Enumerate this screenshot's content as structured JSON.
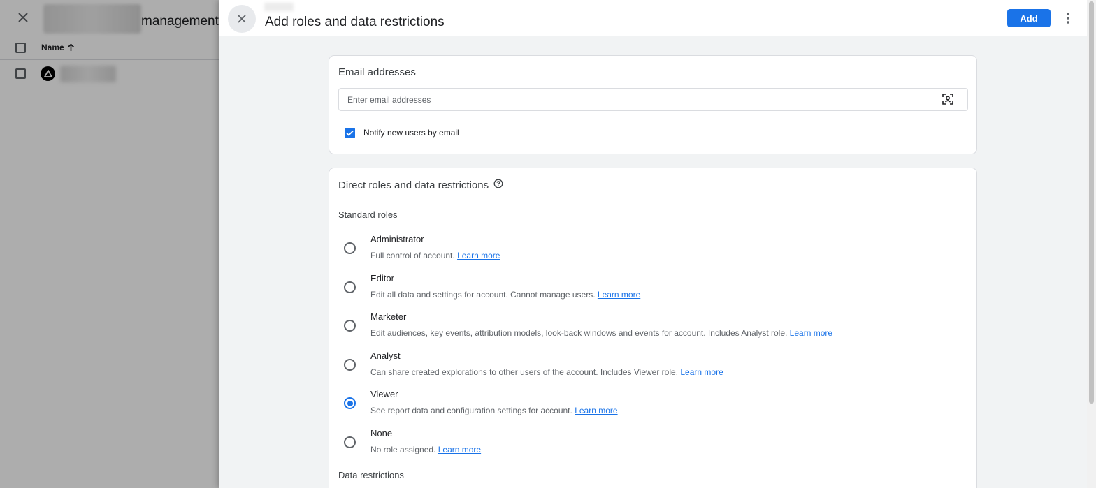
{
  "background": {
    "title_suffix": "management",
    "table": {
      "name_header": "Name"
    }
  },
  "panel": {
    "title": "Add roles and data restrictions",
    "add_label": "Add",
    "email_section": {
      "title": "Email addresses",
      "placeholder": "Enter email addresses",
      "value": "",
      "notify_label": "Notify new users by email",
      "notify_checked": true
    },
    "roles_section": {
      "title": "Direct roles and data restrictions",
      "standard_roles_label": "Standard roles",
      "learn_more_label": "Learn more",
      "roles": [
        {
          "name": "Administrator",
          "description": "Full control of account.",
          "selected": false
        },
        {
          "name": "Editor",
          "description": "Edit all data and settings for account. Cannot manage users.",
          "selected": false
        },
        {
          "name": "Marketer",
          "description": "Edit audiences, key events, attribution models, look-back windows and events for account. Includes Analyst role.",
          "selected": false
        },
        {
          "name": "Analyst",
          "description": "Can share created explorations to other users of the account. Includes Viewer role.",
          "selected": false
        },
        {
          "name": "Viewer",
          "description": "See report data and configuration settings for account.",
          "selected": true
        },
        {
          "name": "None",
          "description": "No role assigned.",
          "selected": false
        }
      ],
      "data_restrictions_label": "Data restrictions"
    }
  },
  "colors": {
    "accent": "#1a73e8",
    "scrim": "rgba(0,0,0,0.32)",
    "panel_bg": "#f1f3f4"
  },
  "icons": {
    "background_close": "close-icon",
    "panel_close": "close-icon",
    "more": "more-vert-icon",
    "contact_picker": "contact-scan-icon",
    "help": "help-outline-icon",
    "sort": "arrow-up-icon"
  }
}
